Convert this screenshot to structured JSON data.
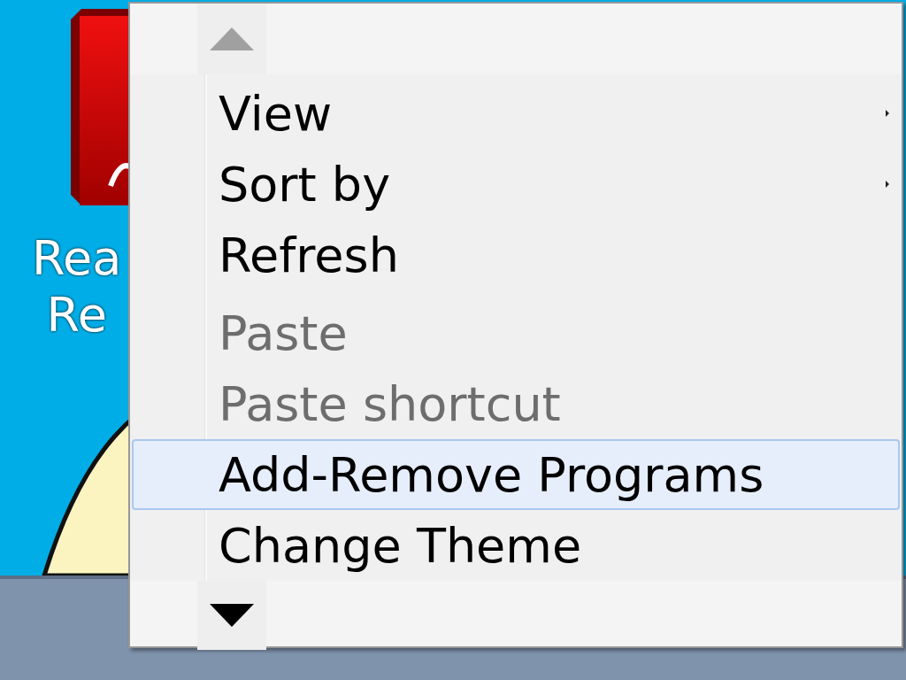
{
  "desktop": {
    "icon": {
      "label_lines": [
        "Rea",
        "Re"
      ]
    }
  },
  "menu": {
    "items": [
      {
        "kind": "item",
        "label": "View",
        "submenu": true,
        "disabled": false,
        "selected": false
      },
      {
        "kind": "item",
        "label": "Sort by",
        "submenu": true,
        "disabled": false,
        "selected": false
      },
      {
        "kind": "item",
        "label": "Refresh",
        "submenu": false,
        "disabled": false,
        "selected": false
      },
      {
        "kind": "separator"
      },
      {
        "kind": "item",
        "label": "Paste",
        "submenu": false,
        "disabled": true,
        "selected": false
      },
      {
        "kind": "item",
        "label": "Paste shortcut",
        "submenu": false,
        "disabled": true,
        "selected": false
      },
      {
        "kind": "item",
        "label": "Add-Remove Programs",
        "submenu": false,
        "disabled": false,
        "selected": true
      },
      {
        "kind": "item",
        "label": "Change Theme",
        "submenu": false,
        "disabled": false,
        "selected": false
      }
    ]
  }
}
